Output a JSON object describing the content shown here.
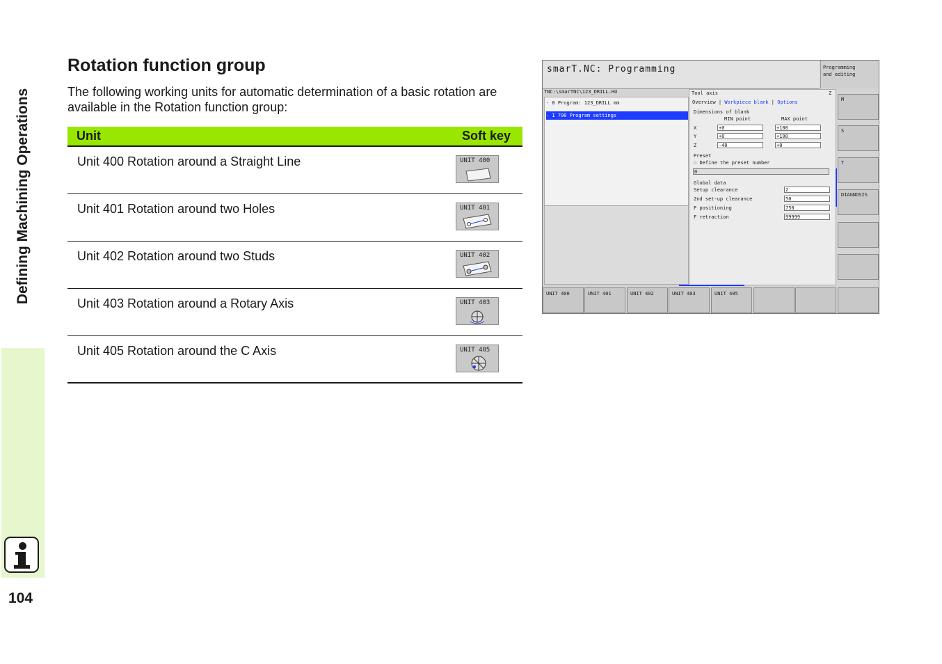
{
  "side": {
    "title": "Defining Machining Operations",
    "page_number": "104"
  },
  "heading": "Rotation function group",
  "intro": "The following working units for automatic determination of a basic rotation are available in the Rotation function group:",
  "table": {
    "headers": {
      "unit": "Unit",
      "softkey": "Soft key"
    },
    "rows": [
      {
        "label": "Unit 400 Rotation around a Straight Line",
        "softkey": "UNIT 400"
      },
      {
        "label": "Unit 401 Rotation around two Holes",
        "softkey": "UNIT 401"
      },
      {
        "label": "Unit 402 Rotation around two Studs",
        "softkey": "UNIT 402"
      },
      {
        "label": "Unit 403 Rotation around a Rotary Axis",
        "softkey": "UNIT 403"
      },
      {
        "label": "Unit 405 Rotation around the C Axis",
        "softkey": "UNIT 405"
      }
    ]
  },
  "screen": {
    "title": "smarT.NC: Programming",
    "mode_line1": "Programming",
    "mode_line2": "and editing",
    "path": "TNC:\\smarTNC\\123_DRILL.HU",
    "tree_row0": "- 0       Program: 123_DRILL mm",
    "tree_row1": "  - 1       700 Program settings",
    "tool_axis_label": "Tool axis",
    "tool_axis_value": "Z",
    "tab_overview": "Overview",
    "tab_workpiece": "Workpiece blank",
    "tab_options": "Options",
    "dims_title": "Dimensions of blank",
    "min_label": "MIN point",
    "max_label": "MAX point",
    "x_label": "X",
    "x_min": "+0",
    "x_max": "+100",
    "y_label": "Y",
    "y_min": "+0",
    "y_max": "+100",
    "z_label": "Z",
    "z_min": "-40",
    "z_max": "+0",
    "preset_title": "Preset",
    "preset_check": "Define the preset number",
    "preset_value": "0",
    "global_title": "Global data",
    "setup_label": "Setup clearance",
    "setup_value": "2",
    "setup2_label": "2nd set-up clearance",
    "setup2_value": "50",
    "fpos_label": "F positioning",
    "fpos_value": "750",
    "fret_label": "F retraction",
    "fret_value": "99999",
    "rkey_m": "M",
    "rkey_s": "S",
    "rkey_t": "T",
    "rkey_diag": "DIAGNOSIS",
    "bkeys": [
      "UNIT 400",
      "UNIT 401",
      "UNIT 402",
      "UNIT 403",
      "UNIT 405"
    ]
  }
}
